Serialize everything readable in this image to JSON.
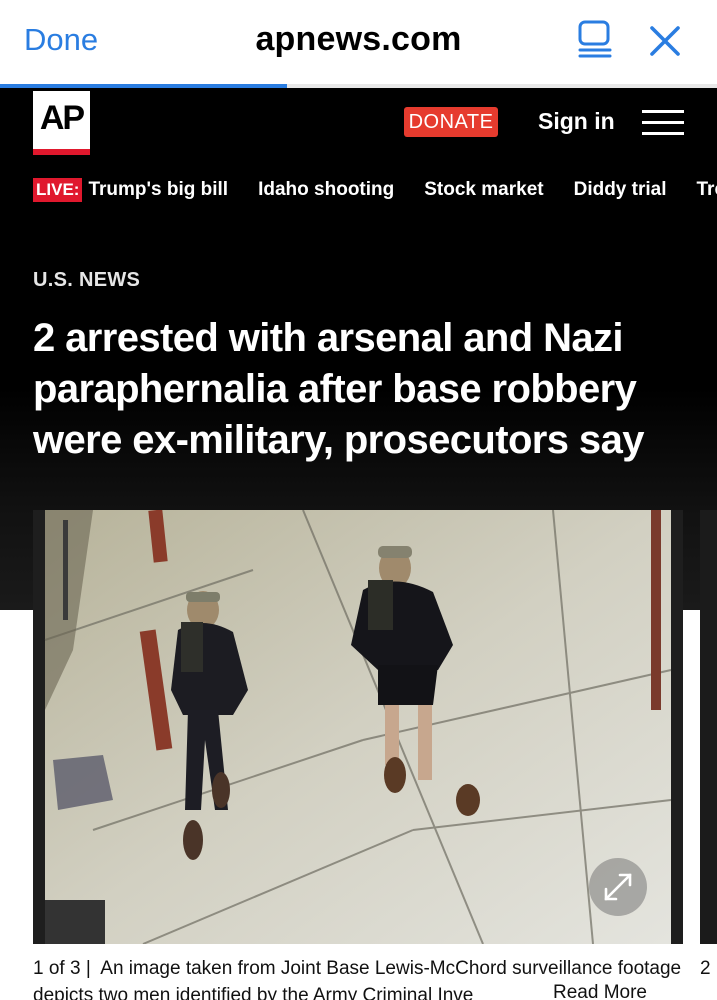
{
  "browser": {
    "done_label": "Done",
    "url": "apnews.com",
    "load_progress": 0.4,
    "icons": [
      "reader-view-icon",
      "close-icon"
    ],
    "accent_color": "#2a7de1"
  },
  "header": {
    "logo_text": "AP",
    "donate_label": "DONATE",
    "signin_label": "Sign in",
    "menu_icon": "hamburger-menu-icon",
    "brand_red": "#e0182d"
  },
  "topics": {
    "live_label": "LIVE:",
    "items": [
      "Trump's big bill",
      "Idaho shooting",
      "Stock market",
      "Diddy trial",
      "Tre"
    ]
  },
  "article": {
    "kicker": "U.S. NEWS",
    "headline": "2 arrested with arsenal and Nazi paraphernalia after base robbery were ex-military, prosecutors say"
  },
  "gallery": {
    "counter": "1 of 3 |",
    "caption": "An image taken from Joint Base Lewis-McChord surveillance footage depicts two men identified by the Army Criminal Inve",
    "read_more": "Read More",
    "next_caption_fragment": "2",
    "expand_icon": "expand-arrows-icon"
  }
}
